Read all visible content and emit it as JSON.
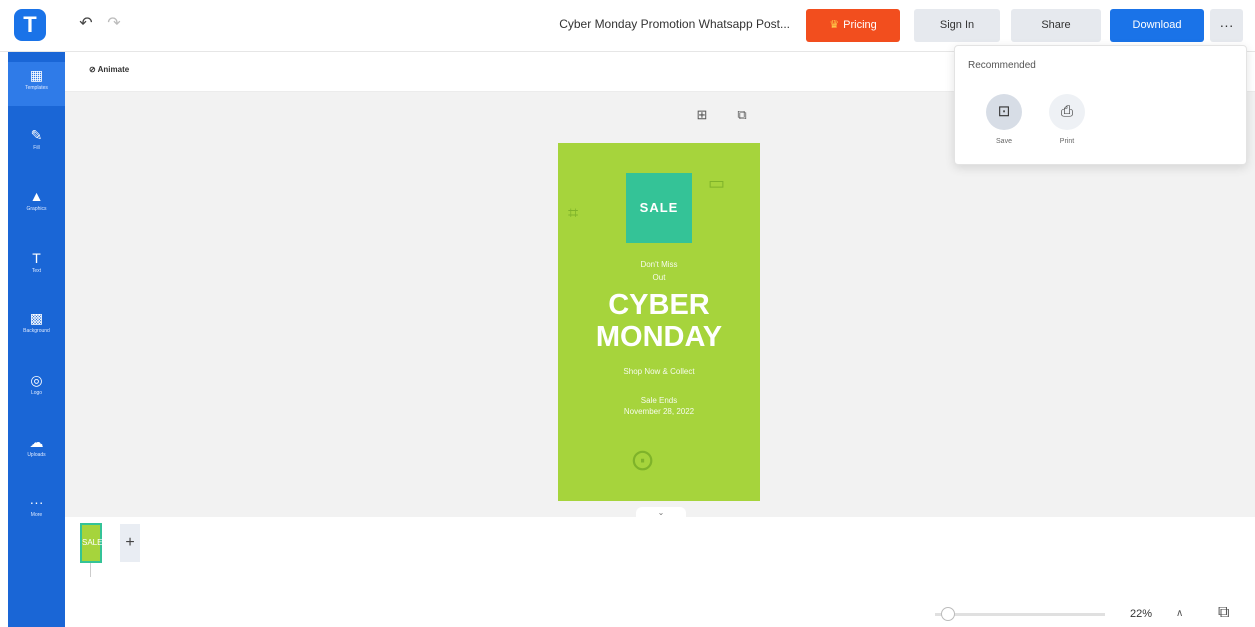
{
  "header": {
    "logo": "T",
    "doc_title": "Cyber Monday Promotion Whatsapp Post...",
    "pricing": "Pricing",
    "sign_in": "Sign In",
    "share": "Share",
    "download": "Download",
    "more": "···"
  },
  "sidebar": {
    "items": [
      {
        "label": "Templates",
        "icon": "▦"
      },
      {
        "label": "Fill",
        "icon": "✎"
      },
      {
        "label": "Graphics",
        "icon": "▲"
      },
      {
        "label": "Text",
        "icon": "T"
      },
      {
        "label": "Background",
        "icon": "▩"
      },
      {
        "label": "Logo",
        "icon": "◎"
      },
      {
        "label": "Uploads",
        "icon": "☁"
      },
      {
        "label": "More",
        "icon": "···"
      }
    ]
  },
  "toolbar": {
    "animate": "Animate"
  },
  "poster": {
    "sale": "SALE",
    "line1": "Don't Miss",
    "line2": "Out",
    "headline1": "CYBER",
    "headline2": "MONDAY",
    "line3": "Shop Now & Collect",
    "line4": "Sale Ends",
    "line5": "November 28, 2022"
  },
  "dropdown": {
    "heading": "Recommended",
    "options": [
      {
        "label": "Save",
        "icon": "⊡"
      },
      {
        "label": "Print",
        "icon": "⎙"
      }
    ]
  },
  "footer": {
    "add_page": "+",
    "zoom": "22%",
    "zoom_level": 0.22
  }
}
